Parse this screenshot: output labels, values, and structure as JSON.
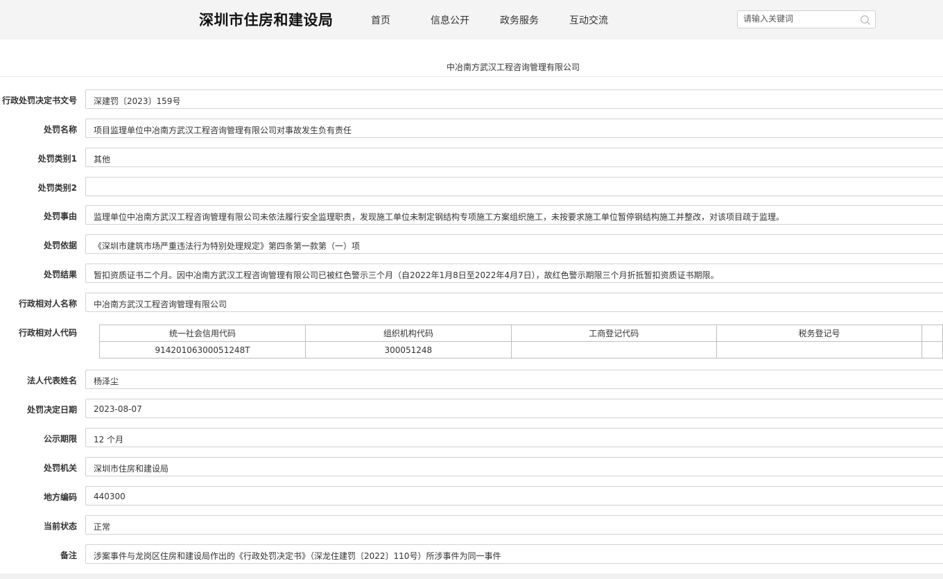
{
  "header": {
    "logo": "深圳市住房和建设局",
    "nav": [
      "首页",
      "信息公开",
      "政务服务",
      "互动交流"
    ],
    "search_placeholder": "请输入关键词"
  },
  "company_title": "中冶南方武汉工程咨询管理有限公司",
  "fields": {
    "doc_number": {
      "label": "行政处罚决定书文号",
      "value": "深建罚〔2023〕159号"
    },
    "penalty_name": {
      "label": "处罚名称",
      "value": "项目监理单位中冶南方武汉工程咨询管理有限公司对事故发生负有责任"
    },
    "category1": {
      "label": "处罚类别1",
      "value": "其他"
    },
    "category2": {
      "label": "处罚类别2",
      "value": ""
    },
    "reason": {
      "label": "处罚事由",
      "value": "监理单位中冶南方武汉工程咨询管理有限公司未依法履行安全监理职责，发现施工单位未制定钢结构专项施工方案组织施工，未按要求施工单位暂停钢结构施工并整改，对该项目疏于监理。"
    },
    "basis": {
      "label": "处罚依据",
      "value": "《深圳市建筑市场严重违法行为特别处理规定》第四条第一款第（一）项"
    },
    "result": {
      "label": "处罚结果",
      "value": "暂扣资质证书二个月。因中冶南方武汉工程咨询管理有限公司已被红色警示三个月（自2022年1月8日至2022年4月7日），故红色警示期限三个月折抵暂扣资质证书期限。"
    },
    "party_name": {
      "label": "行政相对人名称",
      "value": "中冶南方武汉工程咨询管理有限公司"
    },
    "party_code": {
      "label": "行政相对人代码"
    },
    "legal_rep": {
      "label": "法人代表姓名",
      "value": "杨泽尘"
    },
    "decision_date": {
      "label": "处罚决定日期",
      "value": "2023-08-07"
    },
    "publicity_period": {
      "label": "公示期限",
      "value": "12 个月"
    },
    "authority": {
      "label": "处罚机关",
      "value": "深圳市住房和建设局"
    },
    "region_code": {
      "label": "地方编码",
      "value": "440300"
    },
    "status": {
      "label": "当前状态",
      "value": "正常"
    },
    "remark": {
      "label": "备注",
      "value": "涉案事件与龙岗区住房和建设局作出的《行政处罚决定书》（深龙住建罚〔2022〕110号）所涉事件为同一事件"
    }
  },
  "code_table": {
    "headers": [
      "统一社会信用代码",
      "组织机构代码",
      "工商登记代码",
      "税务登记号"
    ],
    "values": [
      "91420106300051248T",
      "300051248",
      "",
      ""
    ]
  }
}
